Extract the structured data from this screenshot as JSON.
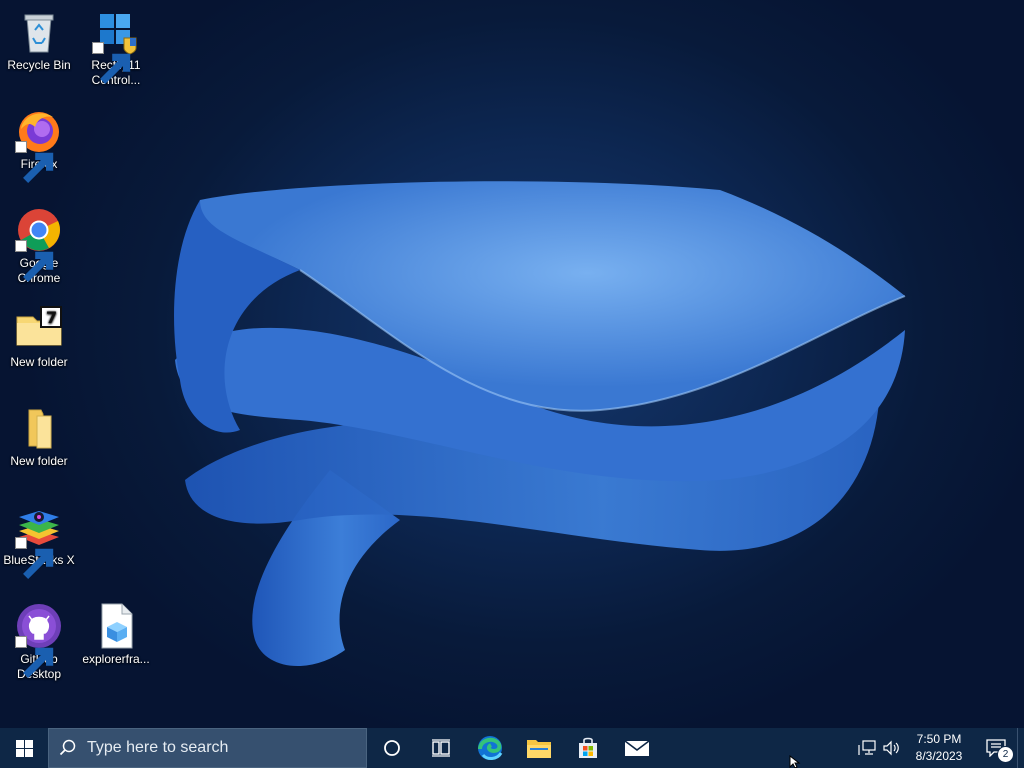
{
  "desktop": {
    "icons": [
      {
        "label": "Recycle Bin",
        "icon": "recycle-bin-icon"
      },
      {
        "label": "Rectify11 Control...",
        "icon": "control-panel-icon"
      },
      {
        "label": "Firefox",
        "icon": "firefox-icon"
      },
      {
        "label": "Google Chrome",
        "icon": "chrome-icon"
      },
      {
        "label": "New folder",
        "icon": "7zip-folder-icon"
      },
      {
        "label": "New folder",
        "icon": "folder-icon"
      },
      {
        "label": "BlueStacks X",
        "icon": "bluestacks-icon"
      },
      {
        "label": "GitHub Desktop",
        "icon": "github-desktop-icon"
      },
      {
        "label": "explorerfra...",
        "icon": "file-icon"
      }
    ]
  },
  "taskbar": {
    "search_placeholder": "Type here to search",
    "pinned": [
      "cortana-icon",
      "task-view-icon",
      "edge-icon",
      "file-explorer-icon",
      "store-icon",
      "mail-icon"
    ],
    "clock": {
      "time": "7:50 PM",
      "date": "8/3/2023"
    },
    "notification_count": "2"
  },
  "colors": {
    "taskbar": "#0e2746",
    "search_box": "#36506f",
    "wallpaper_dark": "#061432",
    "ribbon_blue": "#3a7bd5"
  }
}
